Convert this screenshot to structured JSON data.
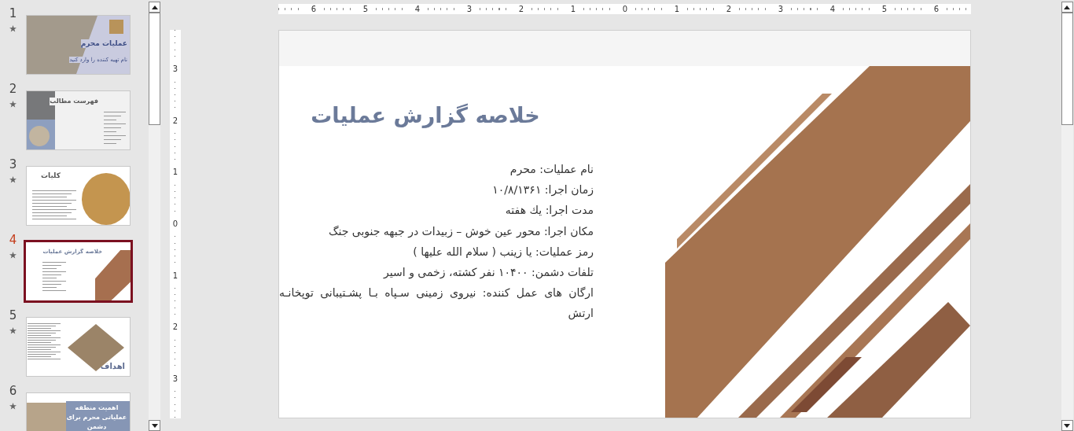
{
  "thumbnails": [
    {
      "number": "1",
      "kind": "cover",
      "selected": false,
      "title": "عملیات محرم",
      "subtitle": "نام تهیه کننده را وارد کنید"
    },
    {
      "number": "2",
      "kind": "toc",
      "selected": false,
      "title": "فهرست مطالب"
    },
    {
      "number": "3",
      "kind": "text-circle",
      "selected": false,
      "title": "کلیات"
    },
    {
      "number": "4",
      "kind": "text-photo",
      "selected": true,
      "title": "خلاصه گزارش عملیات"
    },
    {
      "number": "5",
      "kind": "photo-title",
      "selected": false,
      "title": "اهداف"
    },
    {
      "number": "6",
      "kind": "banner",
      "selected": false,
      "title": "اهمیت منطقه عملیاتی محرم برای دشمن"
    }
  ],
  "ruler": {
    "horizontal": [
      "6",
      "5",
      "4",
      "3",
      "2",
      "1",
      "0",
      "1",
      "2",
      "3",
      "4",
      "5",
      "6"
    ],
    "vertical": [
      "3",
      "2",
      "1",
      "0",
      "1",
      "2",
      "3"
    ]
  },
  "slide": {
    "title": "خلاصه گزارش عملیات",
    "lines": [
      "نام عملیات: محرم",
      "زمان اجرا: ۱۰/۸/۱۳۶۱",
      "مدت اجرا: یك هفته",
      "مکان اجرا: محور عین خوش – زبیدات در جبهه جنوبی جنگ",
      "رمز عملیات: یا زینب ( سلام الله علیها )",
      "تلفات دشمن: ۱۰۴۰۰ نفر کشته، زخمی و اسیر",
      "ارگان های عمل کننده: نیروی زمینی سـپاه بـا پشـتیبانی توپخانـه ارتش"
    ]
  }
}
